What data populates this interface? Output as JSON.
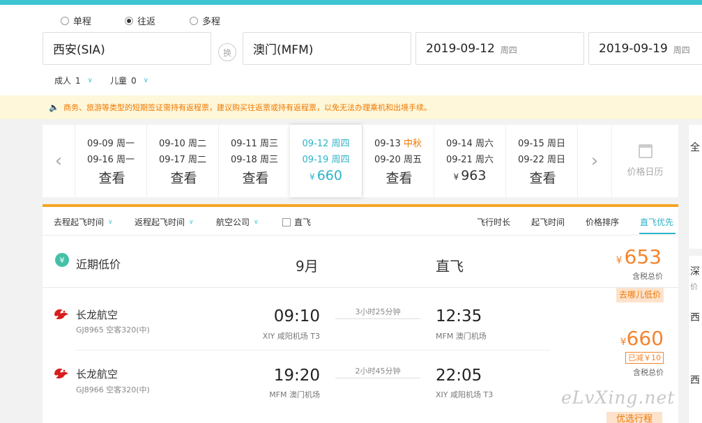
{
  "trip_types": [
    {
      "label": "单程",
      "checked": false
    },
    {
      "label": "往返",
      "checked": true
    },
    {
      "label": "多程",
      "checked": false
    }
  ],
  "search": {
    "from": "西安(SIA)",
    "swap_label": "换",
    "to": "澳门(MFM)",
    "depart_date": "2019-09-12",
    "depart_weekday": "周四",
    "return_date": "2019-09-19",
    "return_weekday": "周四"
  },
  "passengers": {
    "adult_label": "成人",
    "adult_count": "1",
    "child_label": "儿童",
    "child_count": "0"
  },
  "notice": "商务、旅游等类型的短期签证需持有返程票，建议购买往返票或持有返程票，以免无法办理乘机和出境手续。",
  "date_bar": {
    "cells": [
      {
        "d1": "09-09",
        "w1": "周一",
        "d2": "09-16",
        "w2": "周一",
        "price": "查看",
        "yen": ""
      },
      {
        "d1": "09-10",
        "w1": "周二",
        "d2": "09-17",
        "w2": "周二",
        "price": "查看",
        "yen": ""
      },
      {
        "d1": "09-11",
        "w1": "周三",
        "d2": "09-18",
        "w2": "周三",
        "price": "查看",
        "yen": ""
      },
      {
        "d1": "09-12",
        "w1": "周四",
        "d2": "09-19",
        "w2": "周四",
        "price": "660",
        "yen": "¥"
      },
      {
        "d1": "09-13",
        "w1": "中秋",
        "d2": "09-20",
        "w2": "周五",
        "price": "查看",
        "yen": ""
      },
      {
        "d1": "09-14",
        "w1": "周六",
        "d2": "09-21",
        "w2": "周六",
        "price": "963",
        "yen": "¥"
      },
      {
        "d1": "09-15",
        "w1": "周日",
        "d2": "09-22",
        "w2": "周日",
        "price": "查看",
        "yen": ""
      }
    ],
    "calendar_label": "价格日历"
  },
  "filters": {
    "depart_time": "去程起飞时间",
    "return_time": "返程起飞时间",
    "airline": "航空公司",
    "direct_only": "直飞",
    "sorts": [
      {
        "label": "飞行时长",
        "active": false
      },
      {
        "label": "起飞时间",
        "active": false
      },
      {
        "label": "价格排序",
        "active": false
      },
      {
        "label": "直飞优先",
        "active": true
      }
    ]
  },
  "low_price": {
    "icon": "¥",
    "label": "近期低价",
    "month": "9月",
    "type": "直飞",
    "yen": "¥",
    "price": "653",
    "tax_label": "含税总价"
  },
  "flight_card": {
    "tag": "去哪儿低价",
    "legs": [
      {
        "airline": "长龙航空",
        "flight": "GJ8965 空客320(中)",
        "dep_time": "09:10",
        "dep_airport": "XIY 咸阳机场 T3",
        "duration": "3小时25分钟",
        "arr_time": "12:35",
        "arr_airport": "MFM 澳门机场"
      },
      {
        "airline": "长龙航空",
        "flight": "GJ8966 空客320(中)",
        "dep_time": "19:20",
        "dep_airport": "MFM 澳门机场",
        "duration": "2小时45分钟",
        "arr_time": "22:05",
        "arr_airport": "XIY 咸阳机场 T3"
      }
    ],
    "yen": "¥",
    "price": "660",
    "discount": "已减￥10",
    "tax_label": "含税总价",
    "preferred": "优选行程"
  },
  "side_panel": {
    "c1": "全",
    "c2": "深",
    "c3": "价",
    "c4": "西",
    "c5": "西"
  },
  "watermark": "eLvXing.net",
  "colors": {
    "accent": "#3cc4d0",
    "selected": "#2ab4c8",
    "price": "#f5842c",
    "notice_bg": "#fef7d9",
    "tab_bar": "#f5a623"
  }
}
